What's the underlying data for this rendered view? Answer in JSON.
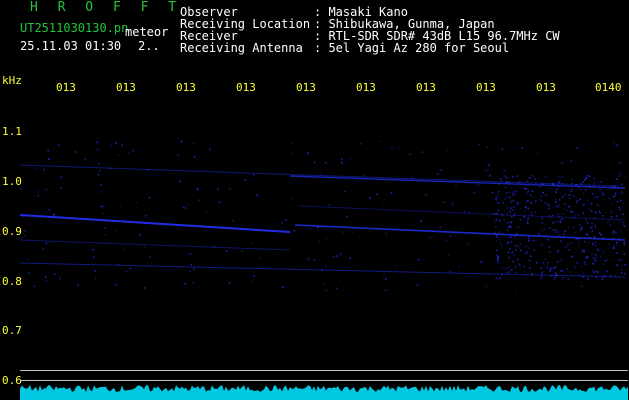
{
  "header": {
    "app_title": "H R O F F T",
    "filename": "UT2511030130.pn",
    "mode": "meteor",
    "datetime": "25.11.03 01:30",
    "extra": "2..",
    "info_labels": [
      "Observer",
      "Receiving Location",
      "Receiver",
      "Receiving Antenna"
    ],
    "info_values": [
      ": Masaki Kano",
      ": Shibukawa, Gunma, Japan",
      ": RTL-SDR SDR# 43dB L15 96.7MHz CW",
      ": 5el Yagi Az 280 for Seoul"
    ]
  },
  "axes": {
    "y_unit": "kHz",
    "y_ticks": [
      "1.1",
      "1.0",
      "0.9",
      "0.8",
      "0.7",
      "0.6"
    ],
    "x_ticks": [
      "013",
      "013",
      "013",
      "013",
      "013",
      "013",
      "013",
      "013",
      "013",
      "0140"
    ]
  },
  "colors": {
    "signal": "#2233ff",
    "noise": "#00c8e0",
    "grid": "#bfbfbf"
  }
}
